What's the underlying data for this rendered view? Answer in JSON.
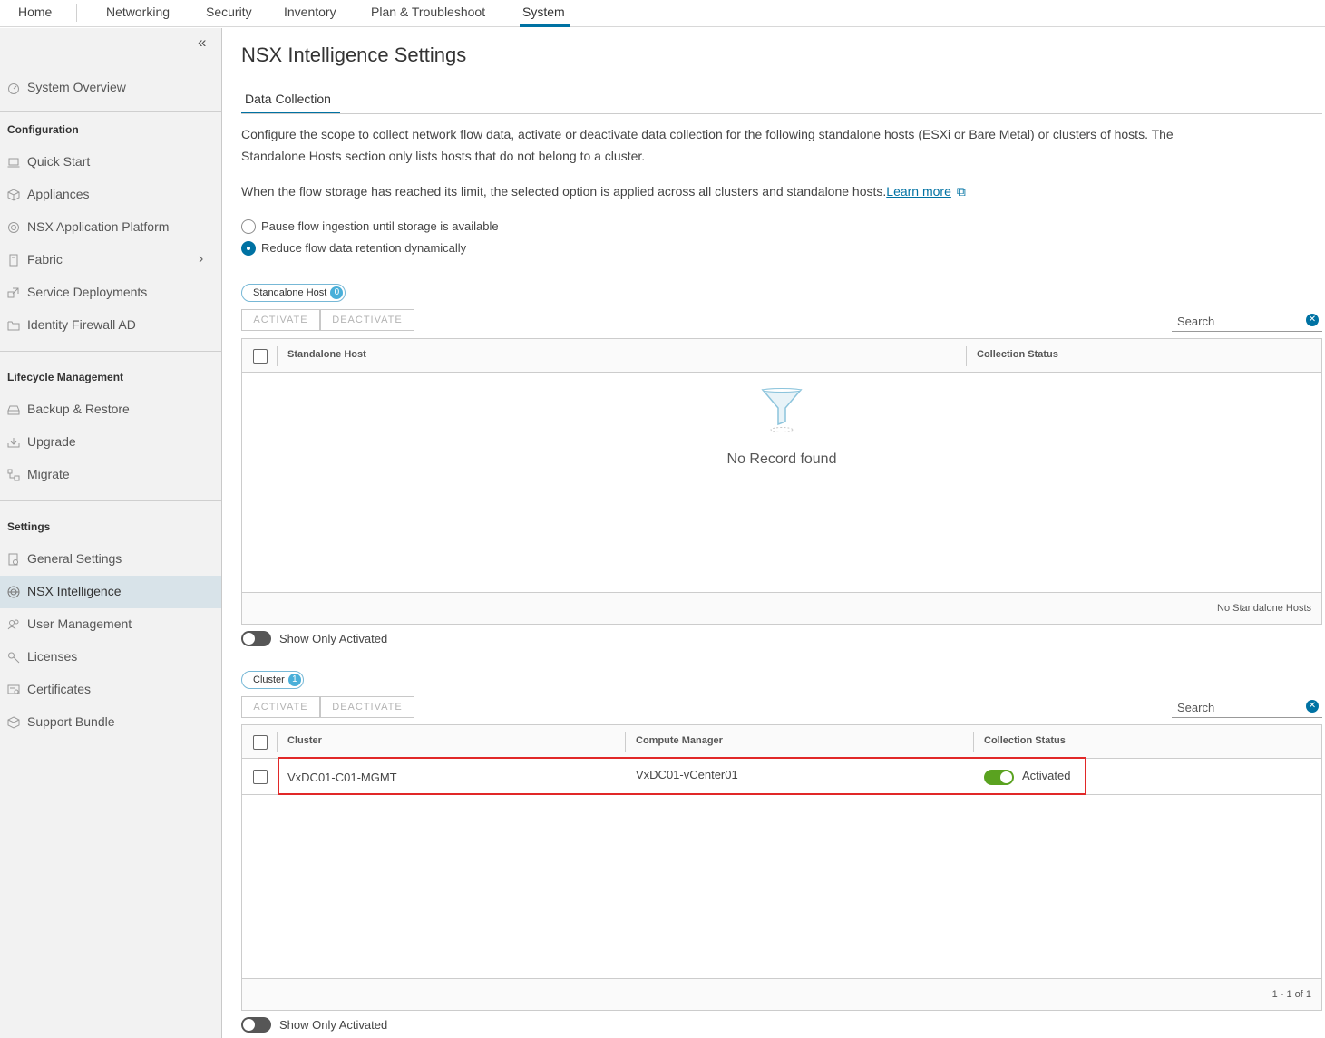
{
  "topnav": {
    "items": [
      "Home",
      "Networking",
      "Security",
      "Inventory",
      "Plan & Troubleshoot",
      "System"
    ],
    "active": "System"
  },
  "sidebar": {
    "collapse_icon": "double-chevron-left-icon",
    "overview": "System Overview",
    "sections": {
      "configuration": "Configuration",
      "lifecycle": "Lifecycle Management",
      "settings": "Settings"
    },
    "config_items": [
      "Quick Start",
      "Appliances",
      "NSX Application Platform",
      "Fabric",
      "Service Deployments",
      "Identity Firewall AD"
    ],
    "lifecycle_items": [
      "Backup & Restore",
      "Upgrade",
      "Migrate"
    ],
    "settings_items": [
      "General Settings",
      "NSX Intelligence",
      "User Management",
      "Licenses",
      "Certificates",
      "Support Bundle"
    ],
    "selected": "NSX Intelligence"
  },
  "page": {
    "title": "NSX Intelligence Settings",
    "tab": "Data Collection",
    "desc1_line1": "Configure the scope to collect network flow data, activate or deactivate data collection for the following standalone hosts (ESXi or Bare Metal) or clusters of hosts. The",
    "desc1_line2": "Standalone Hosts section only lists hosts that do not belong to a cluster.",
    "desc2": "When the flow storage has reached its limit, the selected option is applied across all clusters and standalone hosts.",
    "learn_more": "Learn more",
    "radio_options": [
      "Pause flow ingestion until storage is available",
      "Reduce flow data retention dynamically"
    ],
    "radio_selected": 1
  },
  "standalone": {
    "chip_label": "Standalone Host",
    "chip_count": "0",
    "activate": "ACTIVATE",
    "deactivate": "DEACTIVATE",
    "search_placeholder": "Search",
    "columns": [
      "Standalone Host",
      "Collection Status"
    ],
    "empty_text": "No Record found",
    "footer": "No Standalone Hosts",
    "toggle_label": "Show Only Activated"
  },
  "cluster": {
    "chip_label": "Cluster",
    "chip_count": "1",
    "activate": "ACTIVATE",
    "deactivate": "DEACTIVATE",
    "search_placeholder": "Search",
    "columns": [
      "Cluster",
      "Compute Manager",
      "Collection Status"
    ],
    "rows": [
      {
        "cluster": "VxDC01-C01-MGMT",
        "compute_manager": "VxDC01-vCenter01",
        "status": "Activated"
      }
    ],
    "footer": "1 - 1 of 1",
    "toggle_label": "Show Only Activated"
  },
  "colors": {
    "accent": "#0072a3",
    "activated_green": "#5aa220",
    "highlight_red": "#e12828",
    "sidebar_bg": "#f2f2f2",
    "sidebar_selected": "#d8e3e9"
  }
}
